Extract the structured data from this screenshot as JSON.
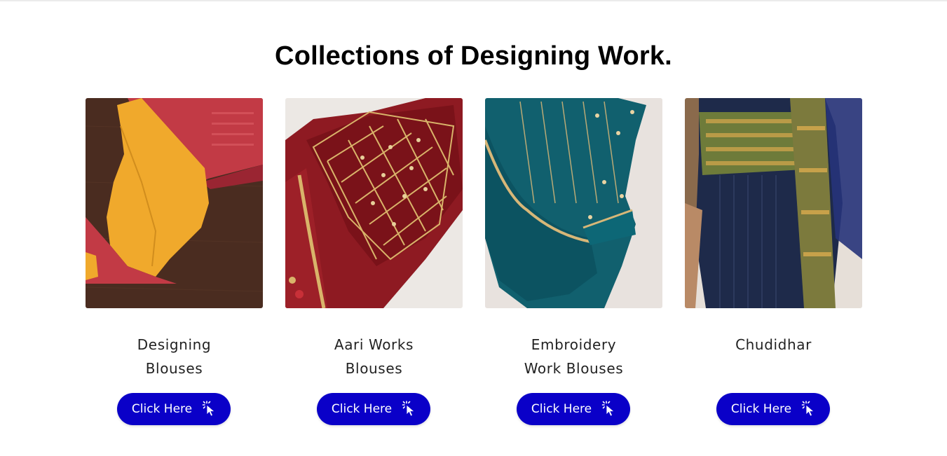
{
  "section": {
    "title": "Collections of  Designing  Work."
  },
  "colors": {
    "button_background": "#0a00c8",
    "button_text": "#ffffff",
    "title_text": "#000000"
  },
  "cards": [
    {
      "title_line1": "Designing",
      "title_line2": "Blouses",
      "button_label": "Click Here",
      "button_icon": "pointer-click-icon",
      "image_alt": "blouse-photo"
    },
    {
      "title_line1": "Aari Works",
      "title_line2": "Blouses",
      "button_label": "Click Here",
      "button_icon": "pointer-click-icon",
      "image_alt": "blouse-photo"
    },
    {
      "title_line1": "Embroidery",
      "title_line2": "Work Blouses",
      "button_label": "Click Here",
      "button_icon": "pointer-click-icon",
      "image_alt": "blouse-photo"
    },
    {
      "title_line1": "Chudidhar",
      "title_line2": "",
      "button_label": "Click Here",
      "button_icon": "pointer-click-icon",
      "image_alt": "chudidhar-photo"
    }
  ]
}
